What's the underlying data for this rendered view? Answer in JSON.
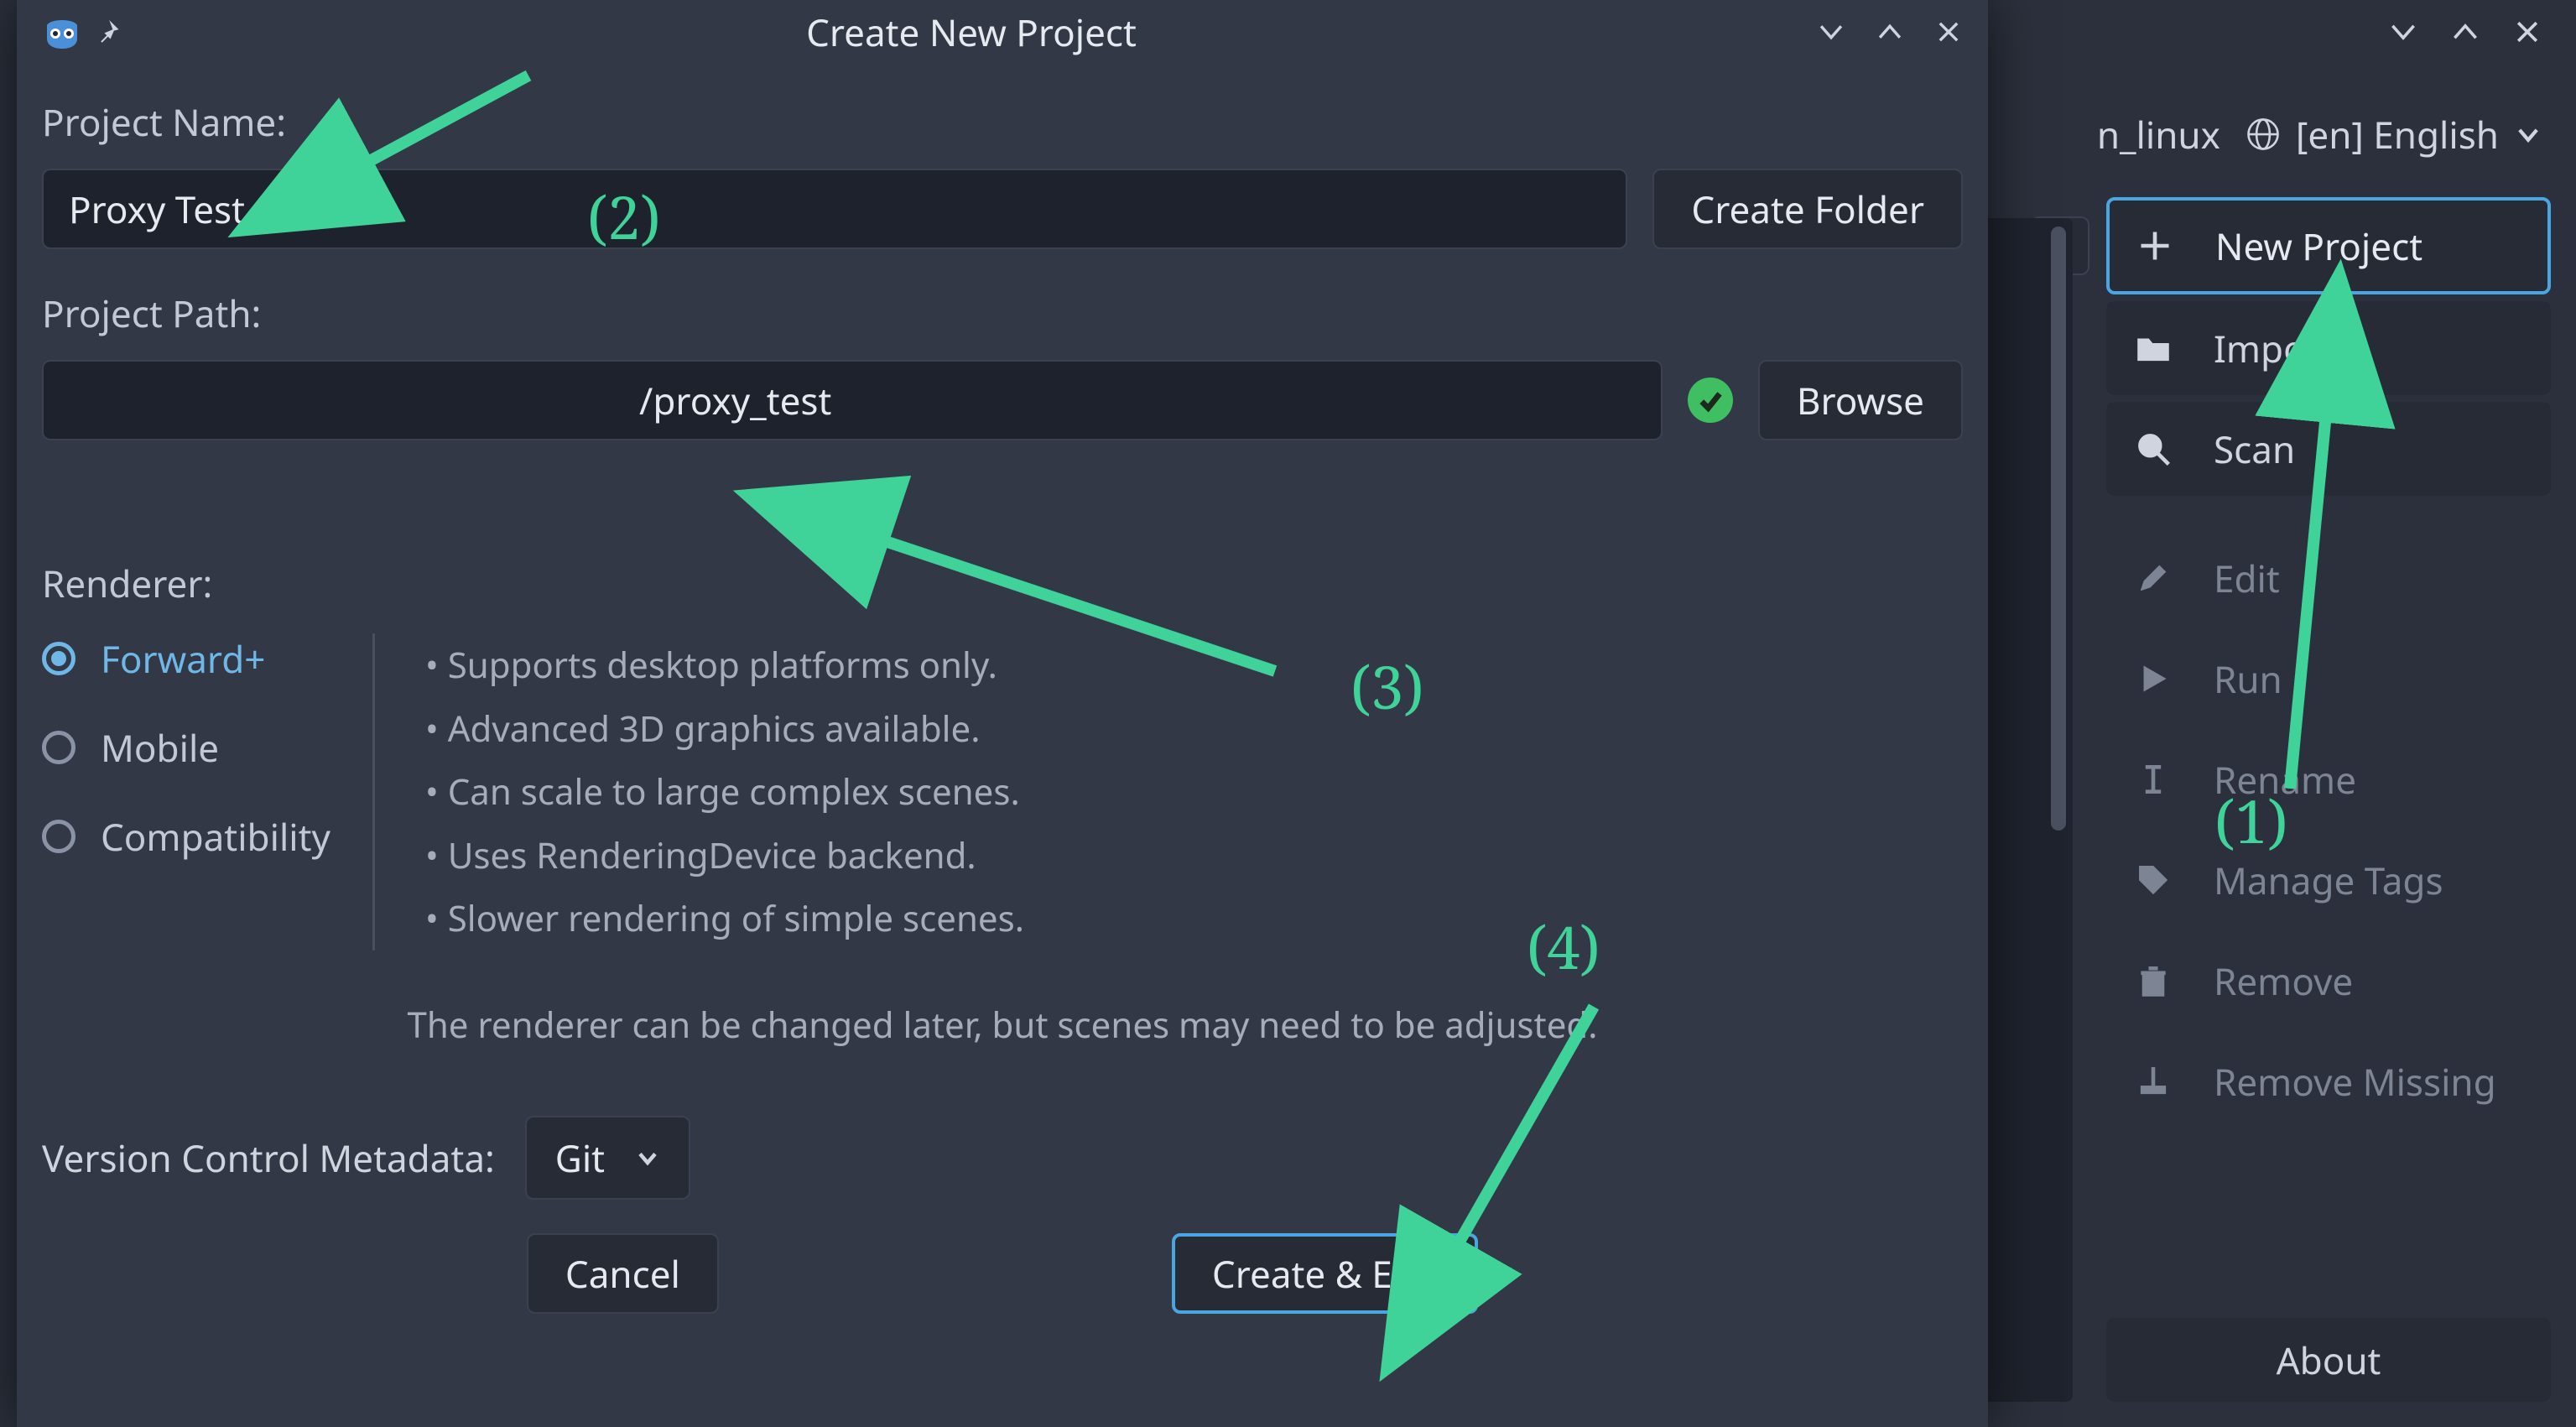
{
  "colors": {
    "accent": "#4aa6e0",
    "annotation": "#3fd39a",
    "ok": "#3fbf62"
  },
  "project_manager": {
    "platform_suffix": "n_linux",
    "language": "[en] English",
    "buttons": {
      "new_project": "New Project",
      "import": "Import",
      "scan": "Scan",
      "edit": "Edit",
      "run": "Run",
      "rename": "Rename",
      "manage_tags": "Manage Tags",
      "remove": "Remove",
      "remove_missing": "Remove Missing",
      "about": "About"
    }
  },
  "dialog": {
    "title": "Create New Project",
    "project_name_label": "Project Name:",
    "project_name_value": "Proxy Test",
    "create_folder": "Create Folder",
    "project_path_label": "Project Path:",
    "project_path_value": "/proxy_test",
    "browse": "Browse",
    "renderer_label": "Renderer:",
    "renderers": {
      "forward": "Forward+",
      "mobile": "Mobile",
      "compat": "Compatibility"
    },
    "renderer_details": [
      "Supports desktop platforms only.",
      "Advanced 3D graphics available.",
      "Can scale to large complex scenes.",
      "Uses RenderingDevice backend.",
      "Slower rendering of simple scenes."
    ],
    "renderer_hint": "The renderer can be changed later, but scenes may need to be adjusted.",
    "vcm_label": "Version Control Metadata:",
    "vcm_value": "Git",
    "cancel": "Cancel",
    "create_edit": "Create & Edit"
  },
  "annotations": {
    "n1": "(1)",
    "n2": "(2)",
    "n3": "(3)",
    "n4": "(4)"
  }
}
